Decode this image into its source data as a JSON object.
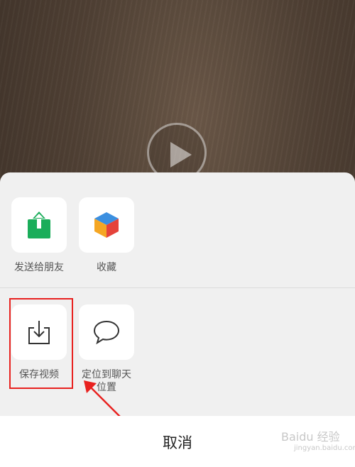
{
  "share_sheet": {
    "row1": [
      {
        "label": "发送给朋友",
        "icon": "share-upload-icon"
      },
      {
        "label": "收藏",
        "icon": "favorite-cube-icon"
      }
    ],
    "row2": [
      {
        "label": "保存视频",
        "icon": "download-save-icon"
      },
      {
        "label": "定位到聊天位置",
        "label_line1": "定位到聊天",
        "label_line2": "位置",
        "icon": "chat-bubble-icon"
      }
    ],
    "cancel_label": "取消"
  },
  "colors": {
    "highlight": "#e8211f",
    "share_green": "#1aad5a"
  },
  "watermark": {
    "logo_text": "Baidu 经验",
    "url_text": "jingyan.baidu.com"
  }
}
